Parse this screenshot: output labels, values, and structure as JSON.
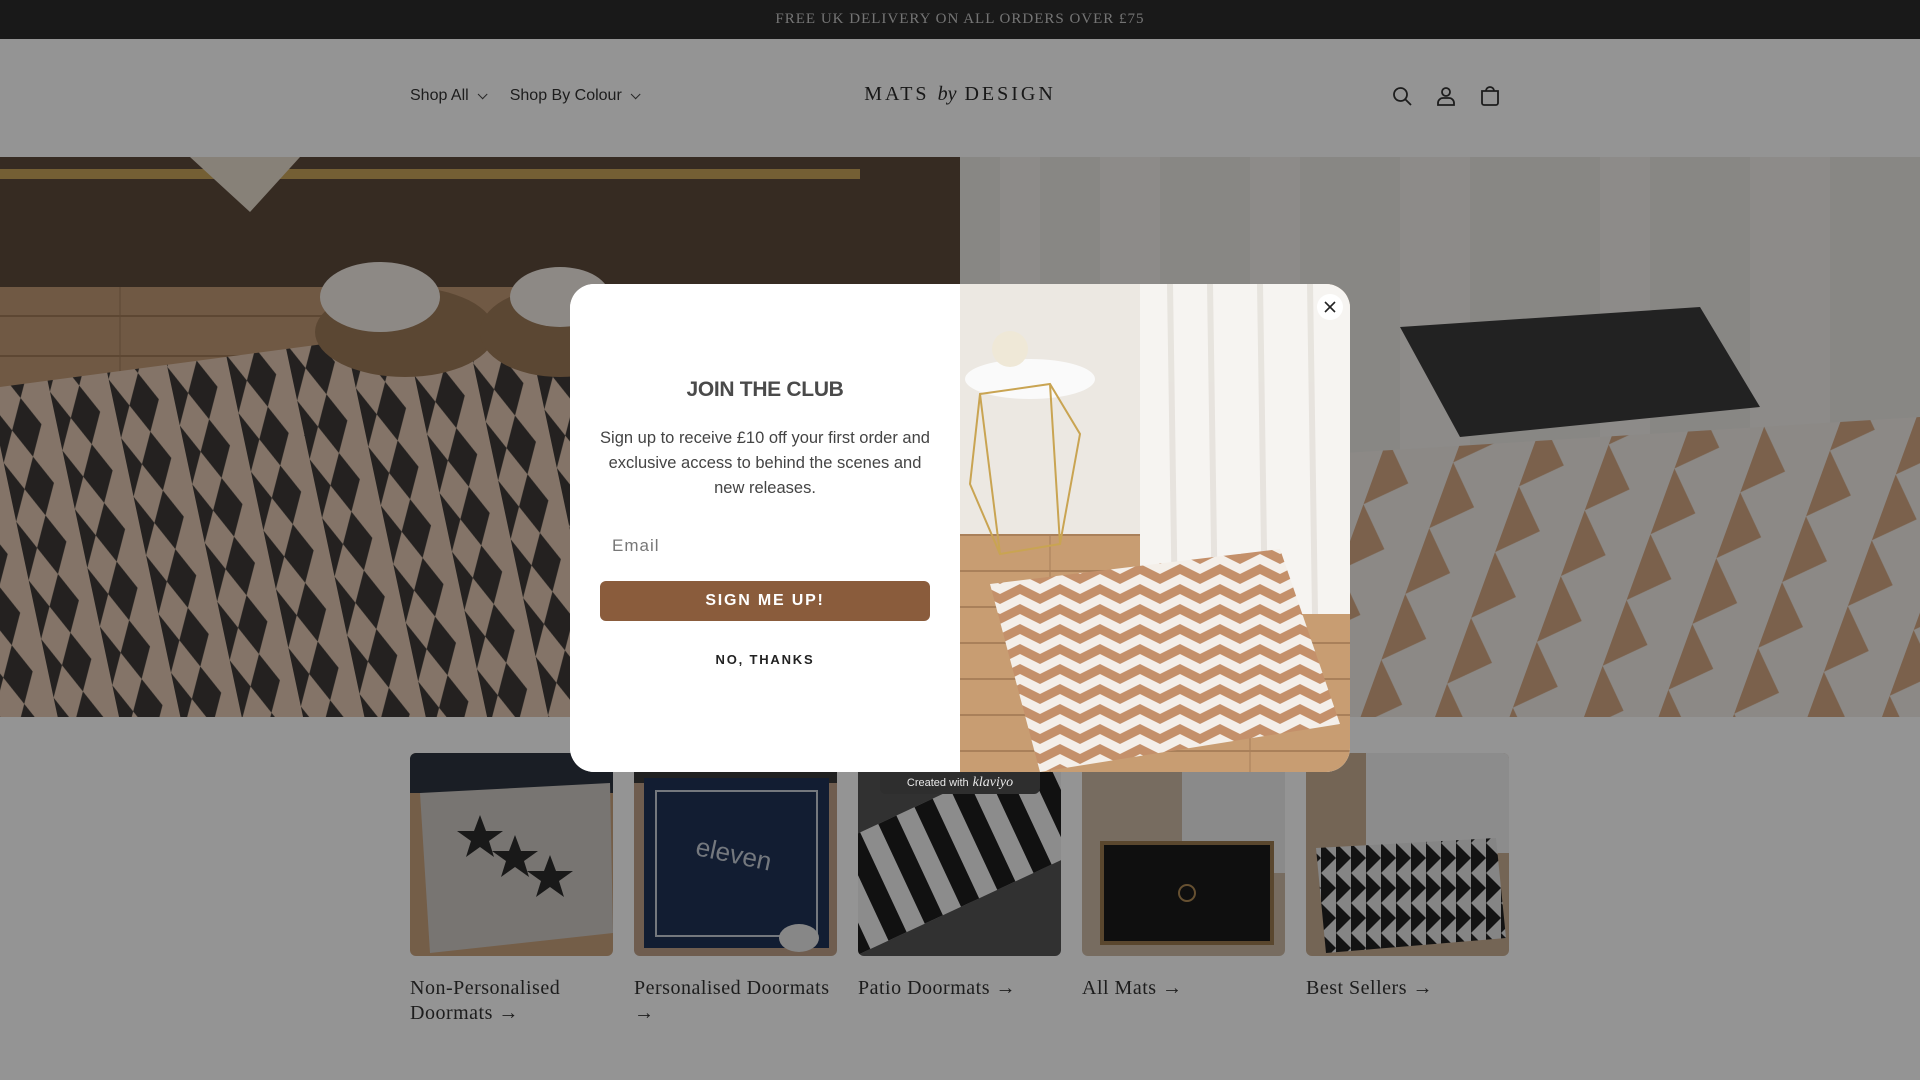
{
  "announcement": {
    "text": "FREE UK DELIVERY ON ALL ORDERS OVER £75"
  },
  "header": {
    "nav": [
      {
        "label": "Shop All"
      },
      {
        "label": "Shop By Colour"
      }
    ],
    "logo": {
      "left": "MATS",
      "by": "by",
      "right": "DESIGN"
    },
    "icons": [
      "search-icon",
      "account-icon",
      "cart-icon"
    ]
  },
  "collections": [
    {
      "title": "Non-Personalised Doormats →"
    },
    {
      "title": "Personalised Doormats →"
    },
    {
      "title": "Patio Doormats →"
    },
    {
      "title": "All Mats →"
    },
    {
      "title": "Best Sellers →"
    }
  ],
  "popup": {
    "title": "JOIN THE CLUB",
    "text": "Sign up to receive £10 off your first order and exclusive access to behind the scenes and new releases.",
    "email_placeholder": "Email",
    "signup_label": "SIGN ME UP!",
    "decline_label": "NO, THANKS",
    "klaviyo_prefix": "Created with",
    "klaviyo_brand": "klaviyo"
  },
  "colors": {
    "accent": "#8a5c3c",
    "announce_bg": "#2c2c2c"
  }
}
